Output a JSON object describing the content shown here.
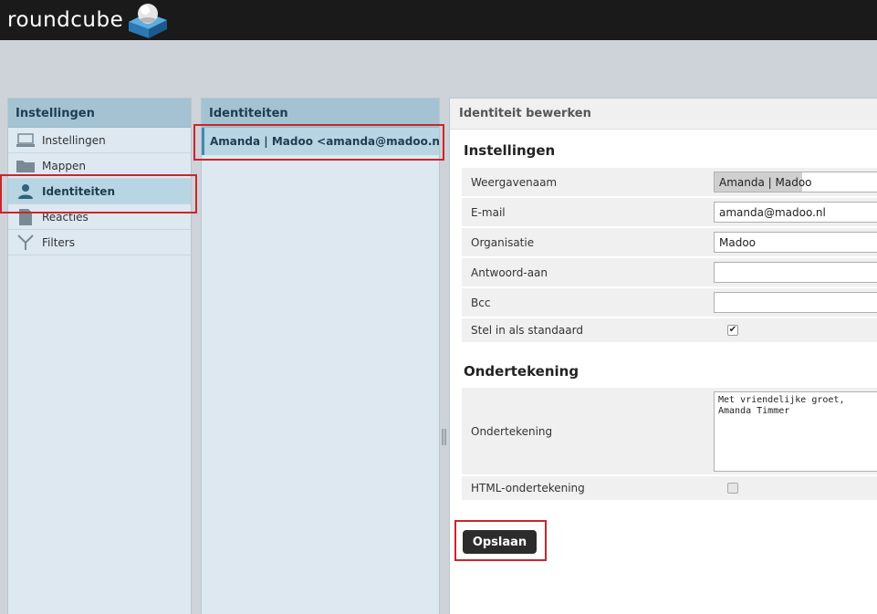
{
  "app": {
    "logo_text": "roundcube"
  },
  "colors": {
    "accent": "#3f8ab2",
    "highlight": "#c9262c",
    "header_bg": "#1a1a1a"
  },
  "settings_panel": {
    "title": "Instellingen",
    "items": [
      {
        "label": "Instellingen",
        "icon": "computer-icon"
      },
      {
        "label": "Mappen",
        "icon": "folder-icon"
      },
      {
        "label": "Identiteiten",
        "icon": "person-icon",
        "selected": true
      },
      {
        "label": "Reacties",
        "icon": "document-icon"
      },
      {
        "label": "Filters",
        "icon": "filter-icon"
      }
    ]
  },
  "identities_panel": {
    "title": "Identiteiten",
    "items": [
      {
        "label": "Amanda | Madoo <amanda@madoo.n..."
      }
    ]
  },
  "edit_panel": {
    "title": "Identiteit bewerken",
    "settings_section": {
      "title": "Instellingen",
      "fields": {
        "display_name": {
          "label": "Weergavenaam",
          "value": "Amanda | Madoo"
        },
        "email": {
          "label": "E-mail",
          "value": "amanda@madoo.nl"
        },
        "organization": {
          "label": "Organisatie",
          "value": "Madoo"
        },
        "reply_to": {
          "label": "Antwoord-aan",
          "value": ""
        },
        "bcc": {
          "label": "Bcc",
          "value": ""
        },
        "default": {
          "label": "Stel in als standaard",
          "checked": true
        }
      }
    },
    "signature_section": {
      "title": "Ondertekening",
      "signature": {
        "label": "Ondertekening",
        "value": "Met vriendelijke groet,\nAmanda Timmer"
      },
      "html_signature": {
        "label": "HTML-ondertekening",
        "checked": false
      }
    },
    "save_label": "Opslaan"
  }
}
